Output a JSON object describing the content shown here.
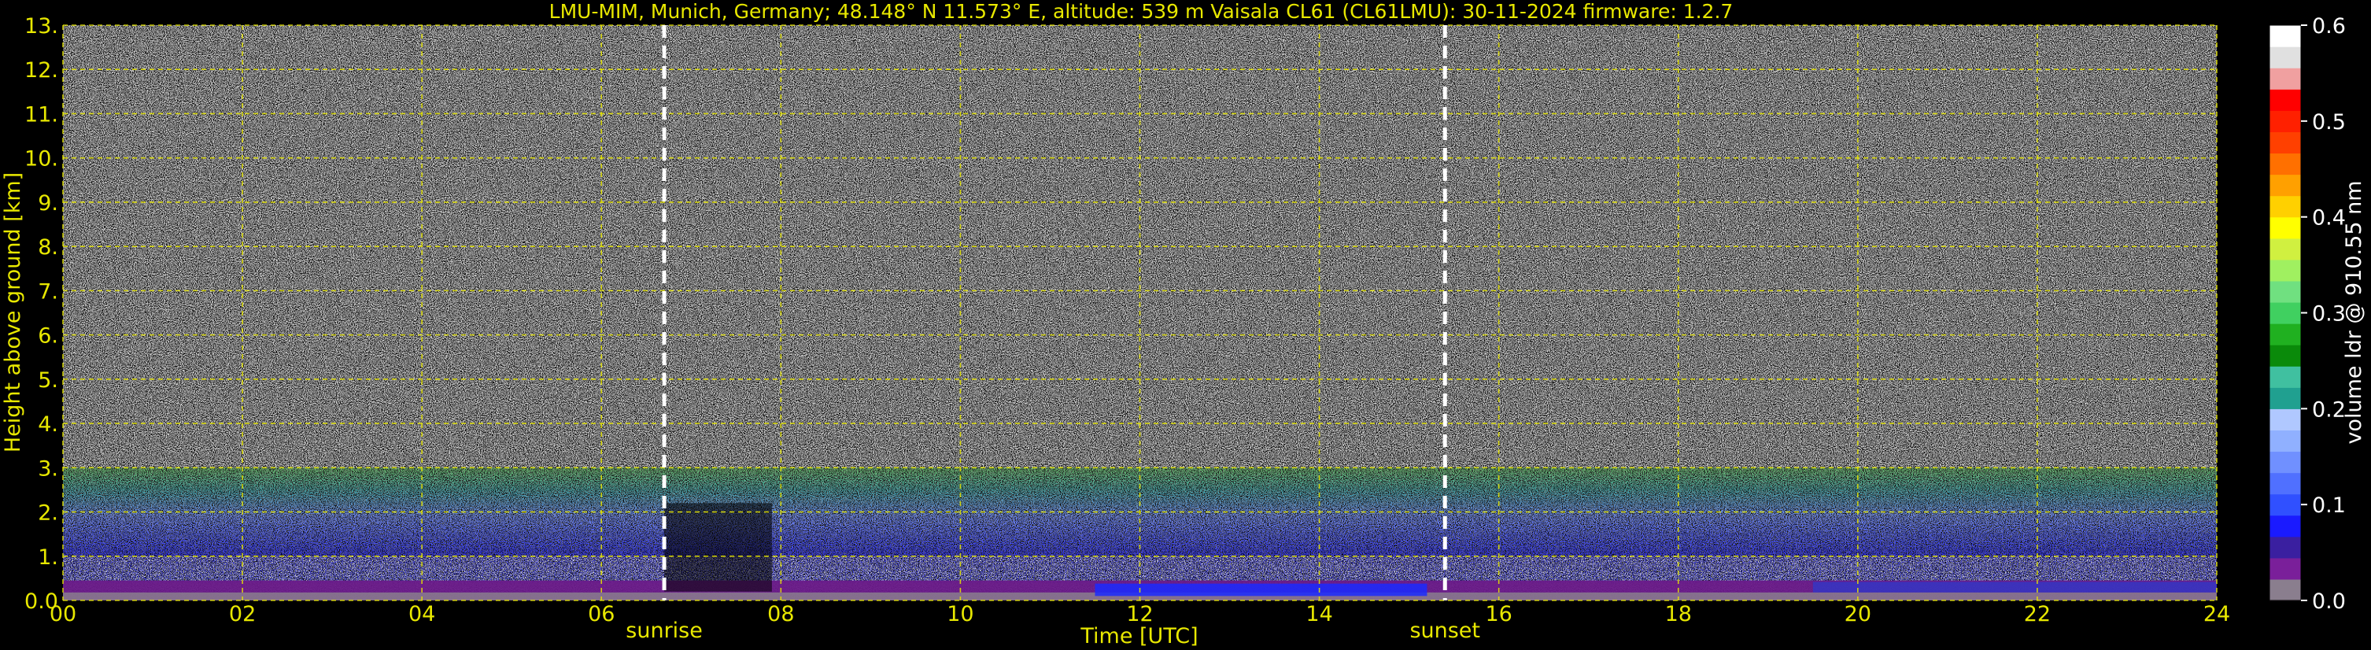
{
  "chart_data": {
    "type": "heatmap",
    "title": "LMU-MIM, Munich, Germany; 48.148° N 11.573° E, altitude: 539 m    Vaisala CL61 (CL61LMU): 30-11-2024    firmware: 1.2.7",
    "xlabel": "Time [UTC]",
    "ylabel": "Height above ground [km]",
    "colorbar_label": "volume ldr @ 910.55 nm",
    "xlim": [
      0,
      24
    ],
    "ylim": [
      0,
      13
    ],
    "clim": [
      0,
      0.6
    ],
    "x_ticks": [
      "00",
      "02",
      "04",
      "06",
      "08",
      "10",
      "12",
      "14",
      "16",
      "18",
      "20",
      "22",
      "24"
    ],
    "y_ticks": [
      "0.0",
      "1.",
      "2.",
      "3.",
      "4.",
      "5.",
      "6.",
      "7.",
      "8.",
      "9.",
      "10.",
      "11.",
      "12.",
      "13."
    ],
    "colorbar_ticks": [
      "0.0",
      "0.1",
      "0.2",
      "0.3",
      "0.4",
      "0.5",
      "0.6"
    ],
    "grid": true,
    "events": [
      {
        "label": "sunrise",
        "time": 6.7
      },
      {
        "label": "sunset",
        "time": 15.4
      }
    ],
    "colormap": [
      "#8a7e8e",
      "#7a1f9a",
      "#3a1fa0",
      "#1a1aff",
      "#3050ff",
      "#5070ff",
      "#7090ff",
      "#90b0ff",
      "#b0c8ff",
      "#20a090",
      "#40c0a0",
      "#0a8a0a",
      "#20b020",
      "#40d060",
      "#70e080",
      "#a0f060",
      "#d0f040",
      "#ffff00",
      "#ffd000",
      "#ffa000",
      "#ff7000",
      "#ff4000",
      "#ff2000",
      "#ff0000",
      "#f0a0a0",
      "#e0e0e0",
      "#ffffff"
    ]
  }
}
